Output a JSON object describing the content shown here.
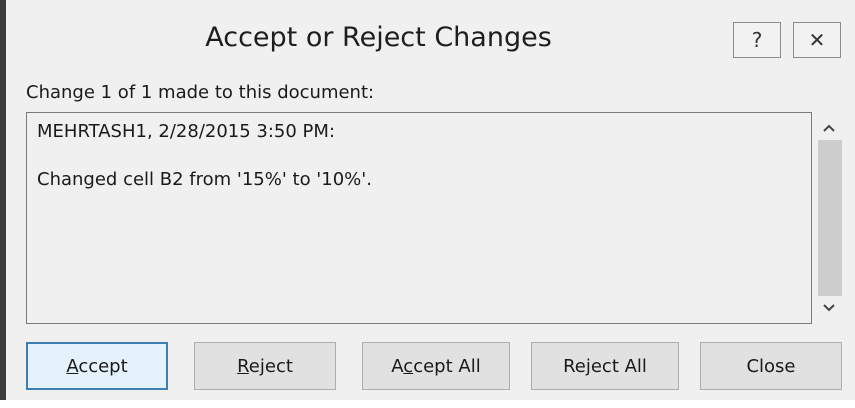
{
  "window": {
    "title": "Accept or Reject Changes",
    "help_glyph": "?",
    "close_glyph": "✕"
  },
  "change_label": "Change 1 of 1 made to this document:",
  "change_details": {
    "author_line": "MEHRTASH1, 2/28/2015 3:50 PM:",
    "description": "Changed cell B2 from '15%' to '10%'."
  },
  "scrollbar": {
    "up_glyph": "⌃",
    "down_glyph": "⌄"
  },
  "buttons": {
    "accept": {
      "pre": "",
      "key": "A",
      "post": "ccept"
    },
    "reject": {
      "pre": "",
      "key": "R",
      "post": "eject"
    },
    "accept_all": {
      "pre": "A",
      "key": "c",
      "post": "cept All"
    },
    "reject_all": {
      "pre": "Re",
      "key": "j",
      "post": "ect All"
    },
    "close": {
      "pre": "Close",
      "key": "",
      "post": ""
    }
  },
  "colors": {
    "dialog_bg": "#f0f0f0",
    "default_button_border": "#3c7fb1",
    "default_button_bg": "#e5f1fb"
  }
}
